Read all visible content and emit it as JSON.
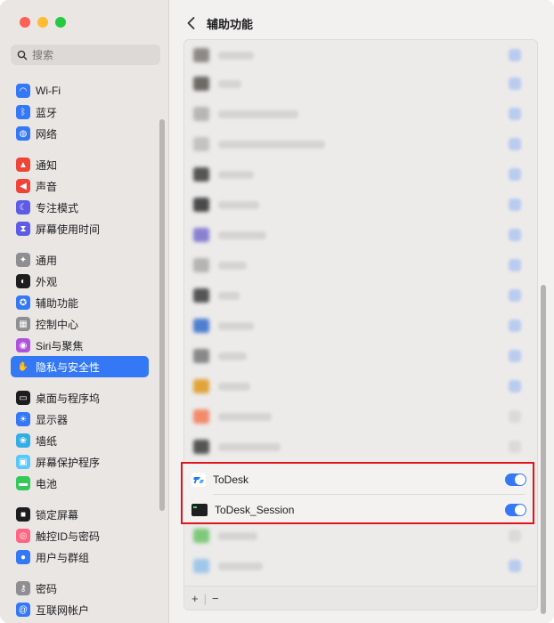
{
  "window": {
    "traffic_colors": [
      "#fe5f57",
      "#febc2e",
      "#28c840"
    ]
  },
  "search": {
    "placeholder": "搜索"
  },
  "sidebar": {
    "groups": [
      [
        {
          "label": "Wi-Fi",
          "icon": "wifi-icon",
          "color": "#3478f6"
        },
        {
          "label": "蓝牙",
          "icon": "bluetooth-icon",
          "color": "#3478f6"
        },
        {
          "label": "网络",
          "icon": "globe-icon",
          "color": "#3478f6"
        }
      ],
      [
        {
          "label": "通知",
          "icon": "bell-icon",
          "color": "#f04438"
        },
        {
          "label": "声音",
          "icon": "speaker-icon",
          "color": "#f04438"
        },
        {
          "label": "专注模式",
          "icon": "moon-icon",
          "color": "#5e5ce6"
        },
        {
          "label": "屏幕使用时间",
          "icon": "hourglass-icon",
          "color": "#5e5ce6"
        }
      ],
      [
        {
          "label": "通用",
          "icon": "gear-icon",
          "color": "#8e8e93"
        },
        {
          "label": "外观",
          "icon": "appearance-icon",
          "color": "#1d1d1f"
        },
        {
          "label": "辅助功能",
          "icon": "accessibility-icon",
          "color": "#3478f6"
        },
        {
          "label": "控制中心",
          "icon": "control-center-icon",
          "color": "#8e8e93"
        },
        {
          "label": "Siri与聚焦",
          "icon": "siri-icon",
          "color": "#af52de"
        },
        {
          "label": "隐私与安全性",
          "icon": "hand-icon",
          "color": "#3478f6",
          "selected": true
        }
      ],
      [
        {
          "label": "桌面与程序坞",
          "icon": "dock-icon",
          "color": "#1d1d1f"
        },
        {
          "label": "显示器",
          "icon": "display-icon",
          "color": "#3478f6"
        },
        {
          "label": "墙纸",
          "icon": "wallpaper-icon",
          "color": "#32ade6"
        },
        {
          "label": "屏幕保护程序",
          "icon": "screensaver-icon",
          "color": "#5ac8fa"
        },
        {
          "label": "电池",
          "icon": "battery-icon",
          "color": "#34c759"
        }
      ],
      [
        {
          "label": "锁定屏幕",
          "icon": "lock-icon",
          "color": "#1d1d1f"
        },
        {
          "label": "触控ID与密码",
          "icon": "fingerprint-icon",
          "color": "#ff6482"
        },
        {
          "label": "用户与群组",
          "icon": "users-icon",
          "color": "#3478f6"
        }
      ],
      [
        {
          "label": "密码",
          "icon": "key-icon",
          "color": "#8e8e93"
        },
        {
          "label": "互联网帐户",
          "icon": "at-icon",
          "color": "#3478f6"
        }
      ]
    ]
  },
  "header": {
    "title": "辅助功能"
  },
  "apps": [
    {
      "label": "ToDesk",
      "icon": "todesk-icon",
      "enabled": true
    },
    {
      "label": "ToDesk_Session",
      "icon": "terminal-icon",
      "enabled": true
    }
  ],
  "footer": {
    "add": "+",
    "remove": "−"
  },
  "colors": {
    "accent": "#3478f6",
    "highlight_border": "#e0141c"
  }
}
